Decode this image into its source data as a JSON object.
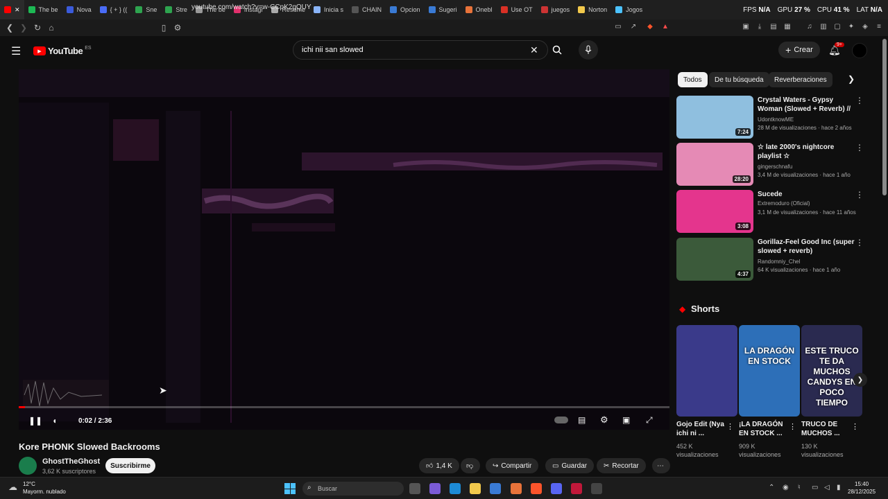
{
  "tabs": [
    "The be",
    "Nova",
    "{ + } ((",
    "Sne",
    "Stre",
    "The be",
    "Instagr",
    "Resume",
    "Inicia s",
    "CHAIN",
    "Opcion",
    "Sugeri",
    "Onebl",
    "Use OT",
    "juegos",
    "Norton",
    "Jogos"
  ],
  "hud": {
    "fps_label": "FPS",
    "fps_value": "N/A",
    "gpu_label": "GPU",
    "gpu_value": "27 %",
    "cpu_label": "CPU",
    "cpu_value": "41 %",
    "lat_label": "LAT",
    "lat_value": "N/A"
  },
  "address_bar": {
    "url": "youtube.com/watch?v=w-CCpK2gQUY"
  },
  "youtube": {
    "logo": "YouTube",
    "logo_country": "ES",
    "search_value": "ichi nii san slowed",
    "create_label": "Crear",
    "notif_badge": "9+"
  },
  "player": {
    "time": "0:02 / 2:36"
  },
  "video": {
    "title": "Kore PHONK Slowed Backrooms",
    "channel": "GhostTheGhost",
    "subscribers": "3,62 K suscriptores",
    "subscribe_label": "Suscribirme",
    "likes": "1,4 K",
    "share_label": "Compartir",
    "save_label": "Guardar",
    "clip_label": "Recortar"
  },
  "chips": [
    "Todos",
    "De tu búsqueda",
    "Reverberaciones"
  ],
  "recommendations": [
    {
      "title": "Crystal Waters - Gypsy Woman (Slowed + Reverb) // Mitsuru ...",
      "channel": "UdontknowME",
      "meta": "28 M de visualizaciones · hace 2 años",
      "duration": "7:24",
      "thumb_color": "#8fbfdf"
    },
    {
      "title": "☆ late 2000's nightcore playlist ☆",
      "channel": "gingerschnafu",
      "meta": "3,4 M de visualizaciones · hace 1 año",
      "duration": "28:20",
      "thumb_color": "#e58ab5"
    },
    {
      "title": "Sucede",
      "channel": "Extremoduro (Oficial)",
      "meta": "3,1 M de visualizaciones · hace 11 años",
      "duration": "3:08",
      "thumb_color": "#e4358d"
    },
    {
      "title": "Gorillaz-Feel Good Inc (super slowed + reverb)",
      "channel": "Randomniy_Chel",
      "meta": "64 K visualizaciones · hace 1 año",
      "duration": "4:37",
      "thumb_color": "#3b5a3a"
    }
  ],
  "shorts_heading": "Shorts",
  "shorts": [
    {
      "title": "Gojo Edit (Nya ichi ni ...",
      "views": "452 K",
      "views_unit": "visualizaciones",
      "color": "#3a3a8a",
      "overlay": ""
    },
    {
      "title": "¡LA DRAGÓN EN STOCK ...",
      "views": "909 K",
      "views_unit": "visualizaciones",
      "color": "#2d6fb8",
      "overlay": "LA DRAGÓN EN STOCK"
    },
    {
      "title": "TRUCO DE MUCHOS ...",
      "views": "130 K",
      "views_unit": "visualizaciones",
      "color": "#2a2a50",
      "overlay": "ESTE TRUCO TE DA MUCHOS CANDYS EN POCO TIEMPO"
    }
  ],
  "taskbar": {
    "weather_temp": "12°C",
    "weather_desc": "Mayorm. nublado",
    "search_placeholder": "Buscar",
    "time": "15:40",
    "date": "28/12/2025"
  },
  "colors": {
    "youtube_red": "#ff0000",
    "background": "#0f0f0f",
    "panel": "#272727"
  }
}
